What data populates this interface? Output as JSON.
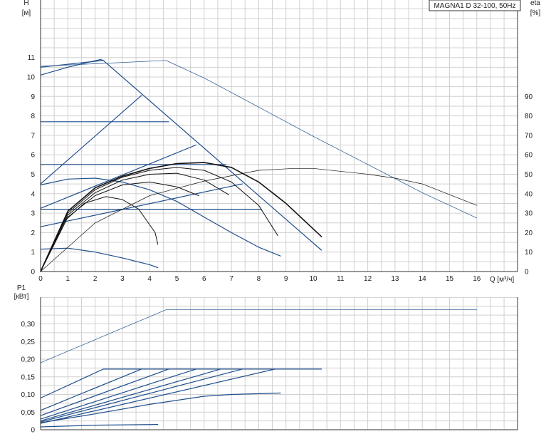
{
  "title": "MAGNA1 D 32-100, 50Hz",
  "colors": {
    "blue": "#1f4e8c",
    "black": "#111111",
    "grid": "#d0d0d0",
    "axis": "#333333"
  },
  "chart_data": [
    {
      "id": "top",
      "type": "line",
      "title": "MAGNA1 D 32-100, 50Hz",
      "xlabel": "Q [м³/ч]",
      "ylabel_left_title": "H",
      "ylabel_left_unit": "[м]",
      "ylabel_right_title": "eta",
      "ylabel_right_unit": "[%]",
      "xlim": [
        0,
        17.5
      ],
      "ylim": [
        0,
        14
      ],
      "y2lim": [
        0,
        140
      ],
      "x_ticks": [
        "0",
        "1",
        "2",
        "3",
        "4",
        "5",
        "6",
        "7",
        "8",
        "9",
        "10",
        "11",
        "12",
        "13",
        "14",
        "15",
        "16"
      ],
      "y_ticks": [
        "0",
        "1",
        "2",
        "3",
        "4",
        "5",
        "6",
        "7",
        "8",
        "9",
        "10",
        "11"
      ],
      "y2_ticks": [
        "0",
        "10",
        "20",
        "30",
        "40",
        "50",
        "60",
        "70",
        "80",
        "90"
      ],
      "grid": true,
      "series": [
        {
          "color": "blue",
          "width": 1.2,
          "x": [
            0,
            2.3,
            10.3
          ],
          "y": [
            10.5,
            10.85,
            1.1
          ]
        },
        {
          "color": "blue",
          "width": 1.2,
          "x": [
            0,
            1.0,
            2.2,
            2.3
          ],
          "y": [
            10.1,
            10.5,
            10.9,
            10.85
          ]
        },
        {
          "color": "blue",
          "width": 1.2,
          "x": [
            0,
            3.7
          ],
          "y": [
            4.5,
            9.05
          ]
        },
        {
          "color": "blue",
          "width": 1.2,
          "x": [
            0,
            4.7
          ],
          "y": [
            7.7,
            7.7
          ]
        },
        {
          "color": "blue",
          "width": 1.2,
          "x": [
            0,
            5.7
          ],
          "y": [
            3.25,
            6.5
          ]
        },
        {
          "color": "blue",
          "width": 1.2,
          "x": [
            0,
            6.8
          ],
          "y": [
            5.5,
            5.5
          ]
        },
        {
          "color": "blue",
          "width": 1.2,
          "x": [
            0,
            7.4
          ],
          "y": [
            2.3,
            4.5
          ]
        },
        {
          "color": "blue",
          "width": 1.2,
          "x": [
            0,
            8.1
          ],
          "y": [
            3.2,
            3.2
          ]
        },
        {
          "color": "blue",
          "width": 1.2,
          "x": [
            0,
            1.0,
            2.0,
            3.0,
            4.0,
            5.0,
            6.0,
            7.0,
            8.0,
            8.8
          ],
          "y": [
            4.45,
            4.75,
            4.8,
            4.6,
            4.2,
            3.6,
            2.8,
            2.0,
            1.25,
            0.8
          ]
        },
        {
          "color": "blue",
          "width": 1.2,
          "x": [
            0,
            1.0,
            2.0,
            3.0,
            4.0,
            4.3
          ],
          "y": [
            1.15,
            1.2,
            1.0,
            0.7,
            0.35,
            0.2
          ]
        },
        {
          "color": "blue",
          "width": 0.7,
          "x": [
            0,
            4.6,
            6.0,
            8.0,
            10.0,
            12.0,
            14.0,
            16.0
          ],
          "y": [
            10.55,
            10.85,
            9.95,
            8.45,
            6.95,
            5.5,
            4.05,
            2.75
          ]
        },
        {
          "color": "black",
          "width": 1.6,
          "x": [
            0,
            1.0,
            2.0,
            3.0,
            4.0,
            5.0,
            6.0,
            7.0,
            8.0,
            9.0,
            10.3
          ],
          "y": [
            0,
            3.1,
            4.3,
            4.9,
            5.3,
            5.55,
            5.6,
            5.35,
            4.6,
            3.5,
            1.8
          ]
        },
        {
          "color": "black",
          "width": 1.0,
          "x": [
            0,
            1.0,
            2.0,
            3.0,
            4.0,
            5.0,
            6.0,
            7.0,
            8.0,
            8.7
          ],
          "y": [
            0,
            3.0,
            4.2,
            4.85,
            5.2,
            5.35,
            5.2,
            4.6,
            3.4,
            1.85
          ]
        },
        {
          "color": "black",
          "width": 1.0,
          "x": [
            0,
            1.0,
            2.0,
            3.0,
            4.0,
            5.0,
            6.0,
            6.9
          ],
          "y": [
            0,
            2.9,
            4.05,
            4.7,
            5.0,
            5.05,
            4.7,
            3.95
          ]
        },
        {
          "color": "black",
          "width": 1.0,
          "x": [
            0,
            1.0,
            2.0,
            3.0,
            4.0,
            5.0,
            5.8
          ],
          "y": [
            0,
            2.8,
            3.9,
            4.45,
            4.6,
            4.35,
            3.9
          ]
        },
        {
          "color": "black",
          "width": 1.0,
          "x": [
            0,
            0.8,
            1.6,
            2.4,
            3.0,
            3.6,
            4.2,
            4.3
          ],
          "y": [
            0,
            2.5,
            3.5,
            3.85,
            3.7,
            3.2,
            2.0,
            1.4
          ]
        },
        {
          "color": "black",
          "width": 0.7,
          "x": [
            0,
            2.0,
            4.0,
            6.0,
            8.0,
            9.3,
            10.0,
            12.0,
            13.0,
            14.0,
            16.0
          ],
          "y": [
            0,
            2.5,
            3.9,
            4.65,
            5.2,
            5.3,
            5.3,
            5.0,
            4.8,
            4.5,
            3.4
          ]
        }
      ]
    },
    {
      "id": "bottom",
      "type": "line",
      "ylabel_title": "P1",
      "ylabel_unit": "[кВт]",
      "xlim": [
        0,
        17.5
      ],
      "ylim": [
        0,
        0.36
      ],
      "y_ticks": [
        "0",
        "0,05",
        "0,10",
        "0,15",
        "0,20",
        "0,25",
        "0,30"
      ],
      "grid": true,
      "series": [
        {
          "color": "blue",
          "width": 0.7,
          "x": [
            0,
            4.6,
            16.0
          ],
          "y": [
            0.19,
            0.34,
            0.34
          ]
        },
        {
          "color": "blue",
          "width": 1.2,
          "x": [
            0,
            2.3,
            10.3
          ],
          "y": [
            0.09,
            0.172,
            0.172
          ]
        },
        {
          "color": "blue",
          "width": 1.2,
          "x": [
            0,
            3.7
          ],
          "y": [
            0.055,
            0.172
          ]
        },
        {
          "color": "blue",
          "width": 1.2,
          "x": [
            0,
            4.7
          ],
          "y": [
            0.04,
            0.172
          ]
        },
        {
          "color": "blue",
          "width": 1.2,
          "x": [
            0,
            5.7
          ],
          "y": [
            0.03,
            0.172
          ]
        },
        {
          "color": "blue",
          "width": 1.2,
          "x": [
            0,
            6.6
          ],
          "y": [
            0.025,
            0.172
          ]
        },
        {
          "color": "blue",
          "width": 1.2,
          "x": [
            0,
            7.4
          ],
          "y": [
            0.022,
            0.172
          ]
        },
        {
          "color": "blue",
          "width": 1.2,
          "x": [
            0,
            8.6
          ],
          "y": [
            0.018,
            0.172
          ]
        },
        {
          "color": "blue",
          "width": 1.2,
          "x": [
            0,
            2.0,
            4.0,
            6.0,
            7.0,
            8.8
          ],
          "y": [
            0.02,
            0.045,
            0.072,
            0.095,
            0.1,
            0.104
          ]
        },
        {
          "color": "blue",
          "width": 1.2,
          "x": [
            0,
            2.0,
            4.3
          ],
          "y": [
            0.008,
            0.013,
            0.015
          ]
        }
      ]
    }
  ]
}
